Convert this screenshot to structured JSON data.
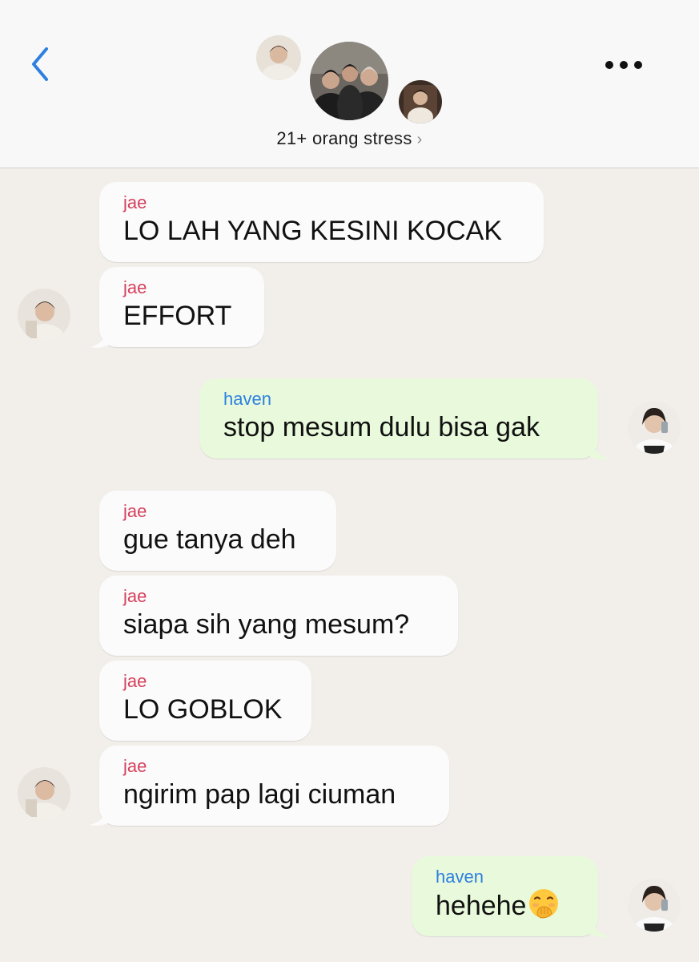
{
  "header": {
    "group_name": "21+ orang stress",
    "chevron": "›"
  },
  "messages": [
    {
      "sender": "jae",
      "text": "LO LAH YANG KESINI KOCAK"
    },
    {
      "sender": "jae",
      "text": "EFFORT"
    },
    {
      "sender": "haven",
      "text": "stop mesum dulu bisa gak"
    },
    {
      "sender": "jae",
      "text": "gue tanya deh"
    },
    {
      "sender": "jae",
      "text": "siapa sih yang mesum?"
    },
    {
      "sender": "jae",
      "text": "LO GOBLOK"
    },
    {
      "sender": "jae",
      "text": "ngirim pap lagi ciuman"
    },
    {
      "sender": "haven",
      "text": "hehehe",
      "emoji": "face-with-hand-over-mouth"
    }
  ],
  "colors": {
    "jae": "#d6415e",
    "haven": "#2d7fe0",
    "incoming_bubble": "#fbfbfb",
    "outgoing_bubble": "#e8fadb",
    "background": "#f2efeb",
    "back_arrow": "#2d7fe0"
  }
}
